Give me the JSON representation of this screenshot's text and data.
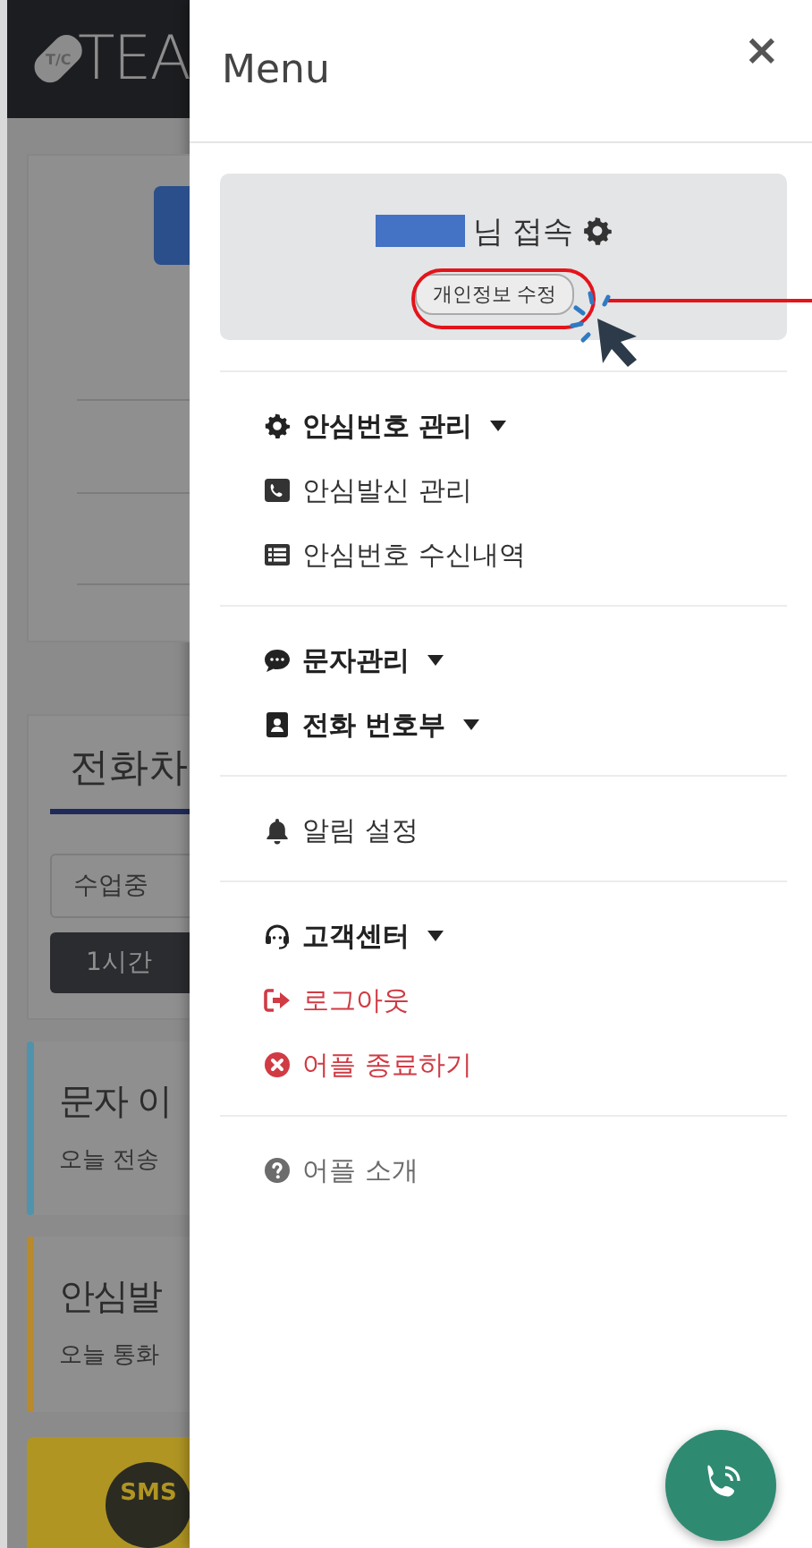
{
  "background": {
    "logo_mark": "T/C",
    "logo_text": "TEA",
    "heading": "전화차",
    "select": {
      "value": "수업중"
    },
    "duration_button": "1시간",
    "cards": [
      {
        "title": "문자 이",
        "subtitle": "오늘 전송",
        "color": "#4f93ad"
      },
      {
        "title": "안심발",
        "subtitle": "오늘 통화",
        "color": "#b98a2c"
      }
    ],
    "sms_badge": "SMS"
  },
  "menu": {
    "title": "Menu",
    "close": "×",
    "user": {
      "greeting": "님 접속",
      "edit_button": "개인정보 수정"
    },
    "sections": [
      {
        "items": [
          {
            "kind": "dropdown",
            "label": "안심번호 관리"
          },
          {
            "kind": "link",
            "label": "안심발신 관리"
          },
          {
            "kind": "link",
            "label": "안심번호 수신내역"
          }
        ]
      },
      {
        "items": [
          {
            "kind": "dropdown",
            "label": "문자관리"
          },
          {
            "kind": "dropdown",
            "label": "전화 번호부"
          }
        ]
      },
      {
        "items": [
          {
            "kind": "link",
            "label": "알림 설정"
          }
        ]
      },
      {
        "items": [
          {
            "kind": "dropdown",
            "label": "고객센터"
          },
          {
            "kind": "danger",
            "label": "로그아웃"
          },
          {
            "kind": "danger",
            "label": "어플 종료하기"
          }
        ]
      },
      {
        "items": [
          {
            "kind": "muted",
            "label": "어플 소개"
          }
        ]
      }
    ]
  }
}
